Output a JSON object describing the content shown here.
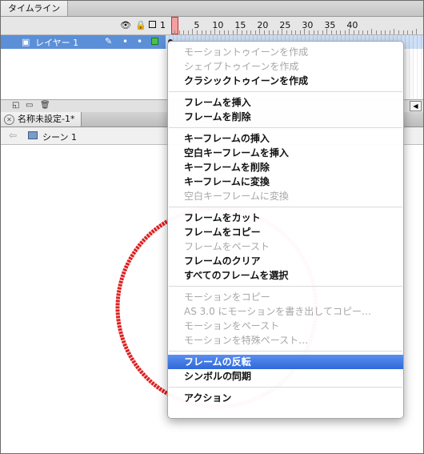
{
  "timeline": {
    "tab_label": "タイムライン",
    "header_one": "1",
    "frame_numbers": [
      "5",
      "10",
      "15",
      "20",
      "25",
      "30",
      "35",
      "40"
    ],
    "layer": {
      "name": "レイヤー 1"
    }
  },
  "document": {
    "tab_label": "名称未設定-1*",
    "scene_label": "シーン 1"
  },
  "context_menu": {
    "items": [
      {
        "label": "モーショントゥイーンを作成",
        "enabled": false
      },
      {
        "label": "シェイプトゥイーンを作成",
        "enabled": false
      },
      {
        "label": "クラシックトゥイーンを作成",
        "enabled": true
      },
      {
        "separator": true
      },
      {
        "label": "フレームを挿入",
        "enabled": true
      },
      {
        "label": "フレームを削除",
        "enabled": true
      },
      {
        "separator": true
      },
      {
        "label": "キーフレームの挿入",
        "enabled": true
      },
      {
        "label": "空白キーフレームを挿入",
        "enabled": true
      },
      {
        "label": "キーフレームを削除",
        "enabled": true
      },
      {
        "label": "キーフレームに変換",
        "enabled": true
      },
      {
        "label": "空白キーフレームに変換",
        "enabled": false
      },
      {
        "separator": true
      },
      {
        "label": "フレームをカット",
        "enabled": true
      },
      {
        "label": "フレームをコピー",
        "enabled": true
      },
      {
        "label": "フレームをペースト",
        "enabled": false
      },
      {
        "label": "フレームのクリア",
        "enabled": true
      },
      {
        "label": "すべてのフレームを選択",
        "enabled": true
      },
      {
        "separator": true
      },
      {
        "label": "モーションをコピー",
        "enabled": false
      },
      {
        "label": "AS 3.0 にモーションを書き出してコピー…",
        "enabled": false
      },
      {
        "label": "モーションをペースト",
        "enabled": false
      },
      {
        "label": "モーションを特殊ペースト…",
        "enabled": false
      },
      {
        "separator": true
      },
      {
        "label": "フレームの反転",
        "enabled": true,
        "highlighted": true
      },
      {
        "label": "シンボルの同期",
        "enabled": true
      },
      {
        "separator": true
      },
      {
        "label": "アクション",
        "enabled": true
      }
    ]
  },
  "colors": {
    "layer_selected": "#5b8fd8",
    "menu_highlight": "#3a73e0",
    "circle_stroke": "#e02020",
    "playhead": "#f4a0a0"
  },
  "icons": [
    "eye-icon",
    "lock-icon",
    "outline-icon",
    "layer-icon",
    "pencil-icon",
    "new-layer-icon",
    "new-folder-icon",
    "trash-icon",
    "close-icon",
    "back-arrow-icon",
    "scene-icon",
    "pointer-cursor-icon"
  ]
}
